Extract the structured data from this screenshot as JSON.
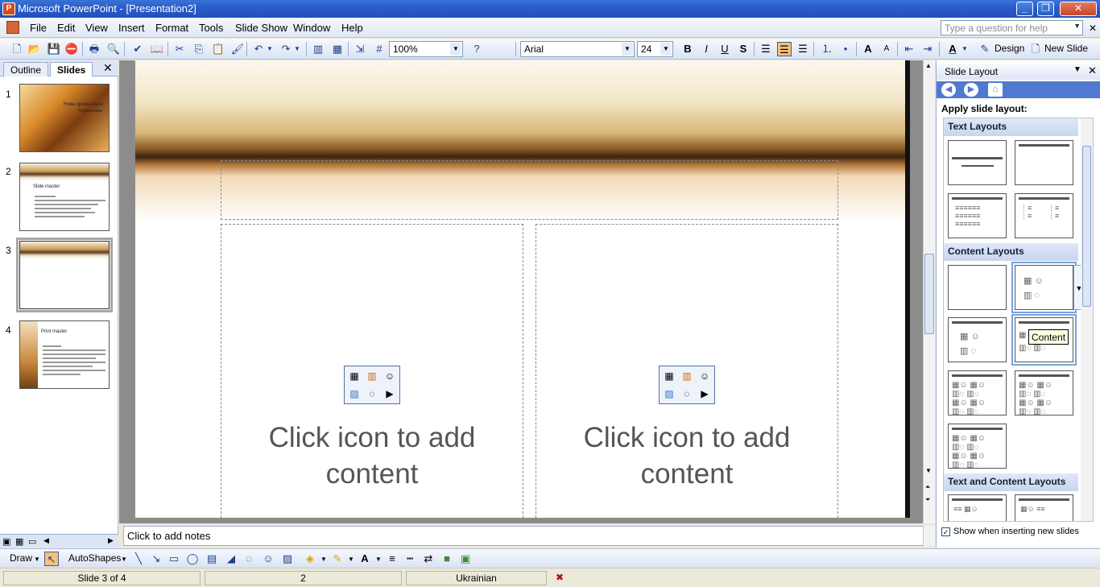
{
  "window": {
    "title": "Microsoft PowerPoint - [Presentation2]"
  },
  "menu": {
    "items": [
      "File",
      "Edit",
      "View",
      "Insert",
      "Format",
      "Tools",
      "Slide Show",
      "Window",
      "Help"
    ]
  },
  "help_box": {
    "placeholder": "Type a question for help"
  },
  "toolbar": {
    "zoom": "100%",
    "font": "Arial",
    "font_size": "24",
    "design_label": "Design",
    "new_slide_label": "New Slide"
  },
  "left_panel": {
    "tabs": [
      "Outline",
      "Slides"
    ],
    "active_tab": "Slides",
    "slides": [
      {
        "number": "1",
        "title": "Нова презентація",
        "subtitle": "Підзаголовок"
      },
      {
        "number": "2",
        "title": "Slide master"
      },
      {
        "number": "3"
      },
      {
        "number": "4",
        "title": "Print master"
      }
    ],
    "selected_slide": "3"
  },
  "slide": {
    "left_placeholder_text": "Click icon to add content",
    "right_placeholder_text": "Click icon to add content"
  },
  "notes": {
    "placeholder": "Click to add notes"
  },
  "task_pane": {
    "title": "Slide Layout",
    "apply_label": "Apply slide layout:",
    "sections": [
      "Text Layouts",
      "Content Layouts",
      "Text and Content Layouts"
    ],
    "tooltip": "Content",
    "show_checkbox_label": "Show when inserting new slides",
    "show_checkbox_checked": true
  },
  "draw_toolbar": {
    "draw_label": "Draw",
    "autoshapes_label": "AutoShapes"
  },
  "status_bar": {
    "slide_position": "Slide 3 of 4",
    "design_number": "2",
    "language": "Ukrainian"
  }
}
